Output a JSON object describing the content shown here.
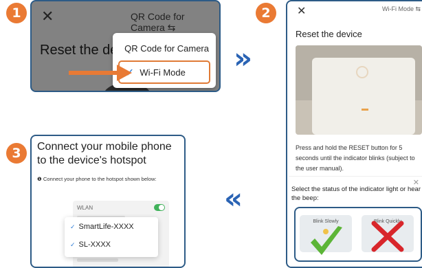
{
  "steps": [
    "1",
    "2",
    "3"
  ],
  "panel1": {
    "close_glyph": "✕",
    "qr_header": "QR Code for Camera ⇆",
    "heading_partial": "Reset the devi",
    "dropdown": {
      "item1": "QR Code for Camera",
      "item2": "Wi-Fi Mode",
      "check": "✓"
    }
  },
  "panel2": {
    "close_glyph": "✕",
    "mode_label": "Wi-Fi Mode ⇆",
    "title": "Reset the device",
    "description": "Press and hold the RESET button for 5 seconds until the indicator blinks (subject to the user manual).",
    "sheet": {
      "close_glyph": "✕",
      "question": "Select the status of the indicator light or hear the beep:",
      "option1": "Blink Slowly",
      "option2": "Blink Quickly"
    }
  },
  "panel3": {
    "heading": "Connect your mobile phone to the device's hotspot",
    "bullet": "❶ Connect your phone to the hotspot shown below:",
    "wlan_label": "WLAN",
    "networks": [
      "SmartLife-XXXX",
      "SL-XXXX"
    ],
    "check": "✓"
  },
  "arrows": {
    "forward": "»",
    "back": "«"
  },
  "colors": {
    "accent_orange": "#e87a35",
    "frame_blue": "#2d5b86",
    "check_blue": "#2b7bd6",
    "arrow_blue": "#2a63b4",
    "ok_green": "#5cb537",
    "bad_red": "#d8262b"
  }
}
